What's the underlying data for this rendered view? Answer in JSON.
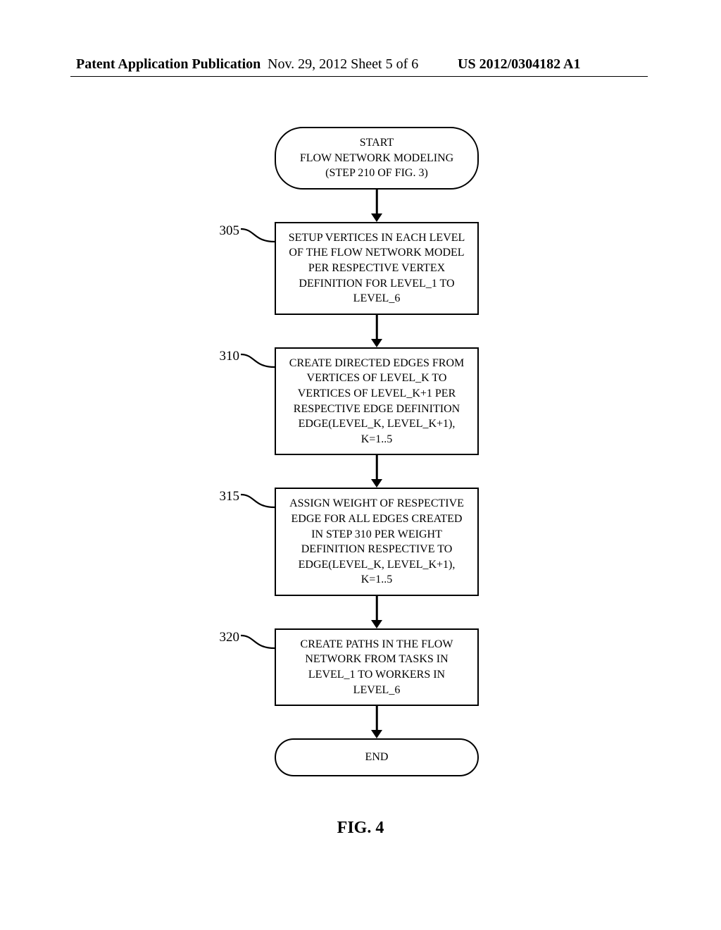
{
  "header": {
    "left": "Patent Application Publication",
    "center": "Nov. 29, 2012  Sheet 5 of 6",
    "right": "US 2012/0304182 A1"
  },
  "flow": {
    "start": {
      "line1": "START",
      "line2": "FLOW NETWORK MODELING",
      "line3": "(STEP 210 OF FIG. 3)"
    },
    "steps": [
      {
        "num": "305",
        "text": "SETUP VERTICES IN EACH LEVEL OF THE FLOW NETWORK MODEL PER RESPECTIVE VERTEX DEFINITION FOR LEVEL_1 TO LEVEL_6"
      },
      {
        "num": "310",
        "text": "CREATE DIRECTED EDGES FROM VERTICES OF LEVEL_K TO VERTICES OF LEVEL_K+1 PER RESPECTIVE EDGE DEFINITION EDGE(LEVEL_K, LEVEL_K+1), K=1..5"
      },
      {
        "num": "315",
        "text": "ASSIGN WEIGHT OF RESPECTIVE EDGE FOR ALL EDGES CREATED IN STEP 310 PER WEIGHT DEFINITION RESPECTIVE TO EDGE(LEVEL_K, LEVEL_K+1), K=1..5"
      },
      {
        "num": "320",
        "text": "CREATE PATHS IN THE FLOW NETWORK FROM TASKS IN LEVEL_1 TO WORKERS IN LEVEL_6"
      }
    ],
    "end": "END"
  },
  "caption": "FIG. 4"
}
